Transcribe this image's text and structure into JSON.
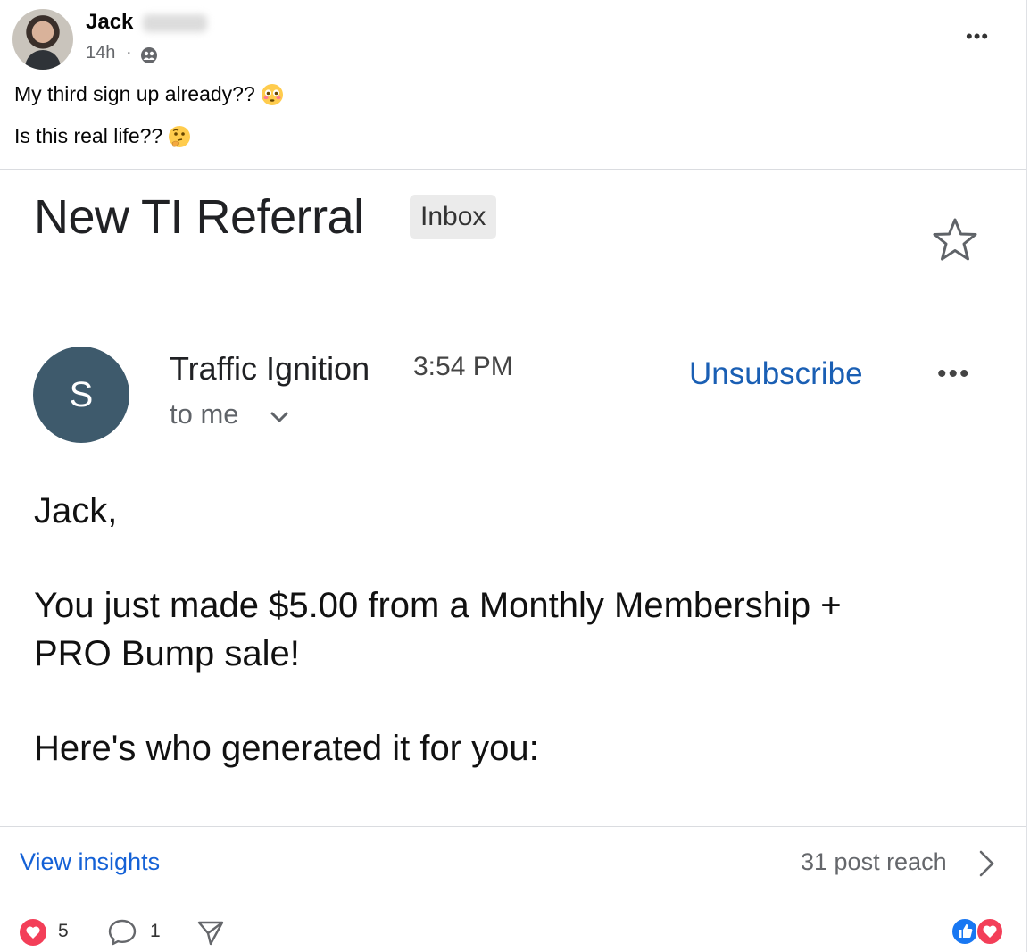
{
  "post": {
    "author": "Jack",
    "time": "14h",
    "separator": "·",
    "audience_icon": "friends-icon",
    "more_label": "•••",
    "lines": [
      {
        "text": "My third sign up already??",
        "emoji": "flushed-face"
      },
      {
        "text": "Is this real life??",
        "emoji": "thinking-face"
      }
    ]
  },
  "email": {
    "subject": "New TI Referral",
    "label": "Inbox",
    "sender_initial": "S",
    "sender_name": "Traffic Ignition",
    "time": "3:54 PM",
    "recipient": "to me",
    "unsubscribe": "Unsubscribe",
    "more_label": "•••",
    "greeting": "Jack,",
    "body_line1": "You just made $5.00 from a Monthly Membership +",
    "body_line2": "PRO Bump sale!",
    "body_line3": "Here's who generated it for you:"
  },
  "footer": {
    "insights_link": "View insights",
    "reach": "31 post reach",
    "like_count": "5",
    "comment_count": "1",
    "reaction_icons": [
      "like-icon",
      "love-icon"
    ]
  },
  "colors": {
    "link_blue": "#1461d6",
    "gmail_link": "#1a5fb4",
    "avatar_slate": "#3e5a6c",
    "love_red": "#f33e58",
    "like_blue": "#1877f2"
  }
}
